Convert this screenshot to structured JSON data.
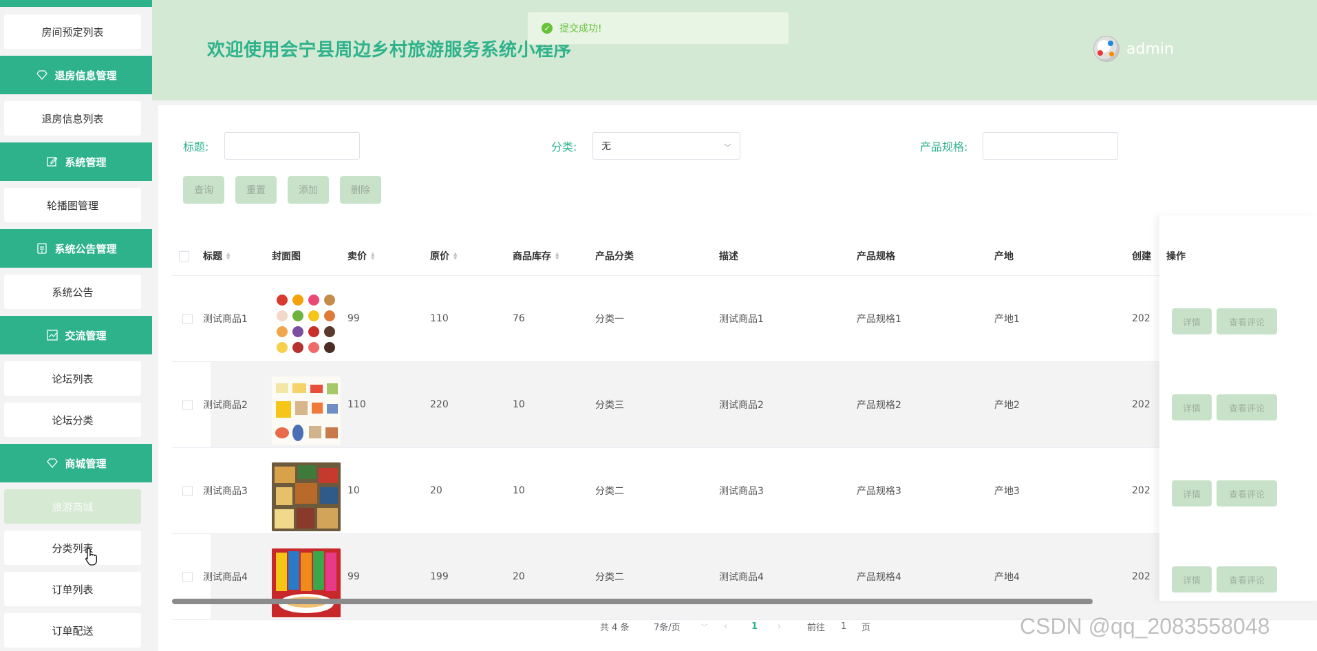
{
  "sidebar": {
    "groups": [
      {
        "key": "checkout",
        "header": "退房信息管理",
        "items": [
          "退房信息列表"
        ]
      },
      {
        "key": "system",
        "header": "系统管理",
        "items": [
          "轮播图管理"
        ]
      },
      {
        "key": "notice",
        "header": "系统公告管理",
        "items": [
          "系统公告"
        ]
      },
      {
        "key": "forum",
        "header": "交流管理",
        "items": [
          "论坛列表",
          "论坛分类"
        ]
      },
      {
        "key": "shop",
        "header": "商城管理",
        "items": [
          "旅游商城",
          "分类列表",
          "订单列表",
          "订单配送"
        ]
      }
    ],
    "top_item": "房间预定列表",
    "active_item": "旅游商城"
  },
  "header": {
    "title": "欢迎使用会宁县周边乡村旅游服务系统小程序",
    "username": "admin"
  },
  "toast": {
    "message": "提交成功!"
  },
  "filters": {
    "title_label": "标题:",
    "title_value": "",
    "category_label": "分类:",
    "category_value": "无",
    "spec_label": "产品规格:",
    "spec_value": ""
  },
  "buttons": {
    "query": "查询",
    "reset": "重置",
    "add": "添加",
    "delete": "删除"
  },
  "table": {
    "columns": {
      "title": "标题",
      "cover": "封面图",
      "price": "卖价",
      "original": "原价",
      "stock": "商品库存",
      "category": "产品分类",
      "desc": "描述",
      "spec": "产品规格",
      "origin": "产地",
      "created": "创建",
      "ops": "操作"
    },
    "rows": [
      {
        "title": "测试商品1",
        "price": "99",
        "original": "110",
        "stock": "76",
        "category": "分类一",
        "desc": "测试商品1",
        "spec": "产品规格1",
        "origin": "产地1",
        "created": "202"
      },
      {
        "title": "测试商品2",
        "price": "110",
        "original": "220",
        "stock": "10",
        "category": "分类三",
        "desc": "测试商品2",
        "spec": "产品规格2",
        "origin": "产地2",
        "created": "202"
      },
      {
        "title": "测试商品3",
        "price": "10",
        "original": "20",
        "stock": "10",
        "category": "分类二",
        "desc": "测试商品3",
        "spec": "产品规格3",
        "origin": "产地3",
        "created": "202"
      },
      {
        "title": "测试商品4",
        "price": "99",
        "original": "199",
        "stock": "20",
        "category": "分类二",
        "desc": "测试商品4",
        "spec": "产品规格4",
        "origin": "产地4",
        "created": "202"
      }
    ],
    "op_detail": "详情",
    "op_comments": "查看评论"
  },
  "pagination": {
    "total": "共 4 条",
    "page_size": "7条/页",
    "current_page": "1",
    "goto_prefix": "前往",
    "goto_value": "1",
    "goto_suffix": "页"
  },
  "watermark": "CSDN @qq_2083558048",
  "colors": {
    "accent": "#2eb28c",
    "header_bg": "#d3e9d3",
    "button_bg": "#c8e2c9"
  }
}
